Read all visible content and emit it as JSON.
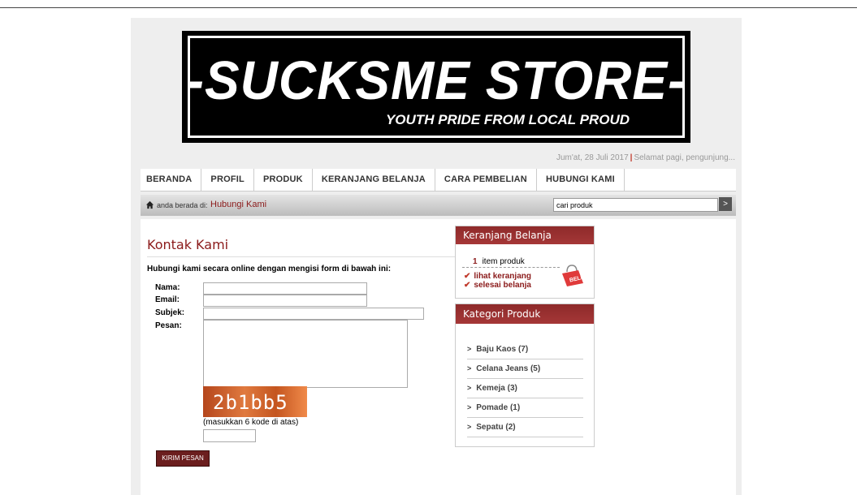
{
  "header": {
    "store_name": "-SUCKSME STORE-",
    "tagline": "YOUTH PRIDE FROM LOCAL PROUD",
    "date": "Jum'at, 28 Juli 2017",
    "greeting": "Selamat pagi, pengunjung..."
  },
  "menu": {
    "items": [
      "BERANDA",
      "PROFIL",
      "PRODUK",
      "KERANJANG BELANJA",
      "CARA PEMBELIAN",
      "HUBUNGI KAMI"
    ]
  },
  "breadcrumb": {
    "label": "anda berada di:",
    "current": "Hubungi Kami"
  },
  "search": {
    "value": "cari produk",
    "button": ">"
  },
  "contact": {
    "title": "Kontak Kami",
    "intro": "Hubungi kami secara online dengan mengisi form di bawah ini:",
    "labels": {
      "nama": "Nama:",
      "email": "Email:",
      "subjek": "Subjek:",
      "pesan": "Pesan:"
    },
    "captcha_text": "2b1bb5",
    "captcha_hint": "(masukkan 6 kode di atas)",
    "submit": "KIRIM PESAN"
  },
  "cart_widget": {
    "title": "Keranjang Belanja",
    "count": "1",
    "count_label": "item produk",
    "link_view": "lihat keranjang",
    "link_finish": "selesai belanja"
  },
  "category_widget": {
    "title": "Kategori Produk",
    "items": [
      "Baju Kaos (7)",
      "Celana Jeans (5)",
      "Kemeja (3)",
      "Pomade (1)",
      "Sepatu (2)"
    ]
  },
  "colors": {
    "accent": "#8b1a1a",
    "widget_header": "#a53737",
    "page_bg": "#eeeeee"
  }
}
